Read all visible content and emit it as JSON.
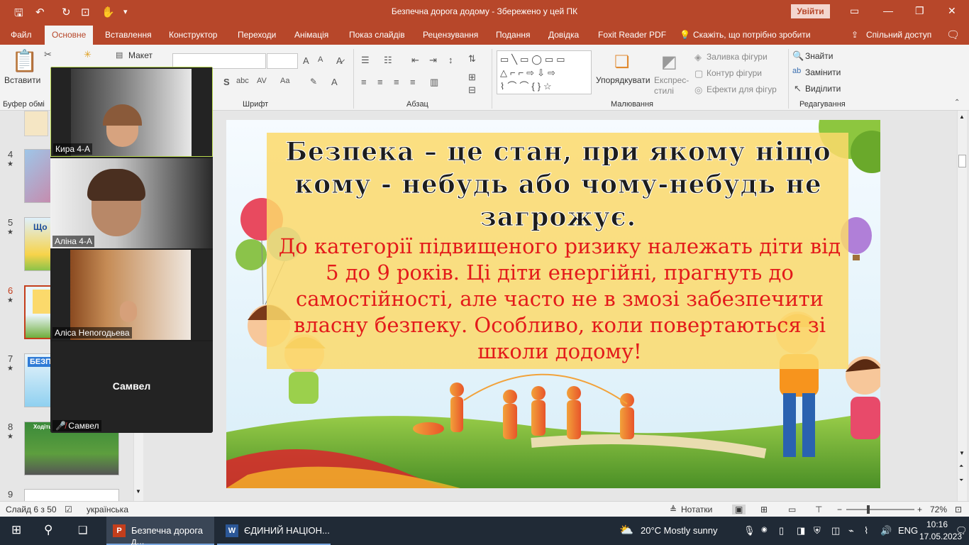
{
  "window": {
    "title": "Безпечна дорога додому  -  Збережено у цей ПК",
    "sign_in": "Увійти"
  },
  "menu_tabs": [
    "Файл",
    "Основне",
    "Вставлення",
    "Конструктор",
    "Переходи",
    "Анімація",
    "Показ слайдів",
    "Рецензування",
    "Подання",
    "Довідка",
    "Foxit Reader PDF"
  ],
  "tell_me": "Скажіть, що потрібно зробити",
  "share": "Спільний доступ",
  "ribbon": {
    "paste": "Вставити",
    "layout": "Макет",
    "groups": {
      "clipboard": "Буфер обмі",
      "font": "Шрифт",
      "paragraph": "Абзац",
      "drawing": "Малювання",
      "editing": "Редагування"
    },
    "arrange": "Упорядкувати",
    "quick_styles": "Експрес-стилі",
    "shape_fill": "Заливка фігури",
    "shape_outline": "Контур фігури",
    "shape_effects": "Ефекти для фігур",
    "find": "Знайти",
    "replace": "Замінити",
    "select": "Виділити"
  },
  "thumbnails": [
    {
      "num": "4",
      "star": "★",
      "label": ""
    },
    {
      "num": "5",
      "star": "★",
      "label": "Що"
    },
    {
      "num": "6",
      "star": "★",
      "label": ""
    },
    {
      "num": "7",
      "star": "★",
      "label": "БЕЗПЕ"
    },
    {
      "num": "8",
      "star": "★",
      "label": "Ходіть"
    },
    {
      "num": "9",
      "star": "",
      "label": ""
    }
  ],
  "slide": {
    "title": "Безпека – це стан, при якому ніщо кому - небудь  або чому-небудь не загрожує.",
    "body": "До категорії підвищеного ризику належать діти від 5 до 9 років. Ці діти енергійні, прагнуть до самостійності, але часто не в змозі забезпечити власну безпеку. Особливо, коли повертаються зі школи додому!"
  },
  "participants": [
    {
      "name": "Кира 4-А"
    },
    {
      "name": "Аліна 4-А"
    },
    {
      "name": "Аліса Непогодьева"
    },
    {
      "name": "Самвел",
      "center": "Самвел"
    }
  ],
  "status": {
    "slide": "Слайд 6 з 50",
    "language": "українська",
    "notes": "Нотатки",
    "zoom": "72%"
  },
  "taskbar": {
    "app1": "Безпечна дорога д...",
    "app2": "ЄДИНИЙ НАЦІОН...",
    "weather": "20°C  Mostly sunny",
    "lang": "ENG",
    "time": "10:16",
    "date": "17.05.2023"
  },
  "colors": {
    "accent": "#b7472a",
    "slide_title": "#1d1d1d",
    "slide_body": "#e31a1a",
    "slide_box": "#fbd96b"
  }
}
